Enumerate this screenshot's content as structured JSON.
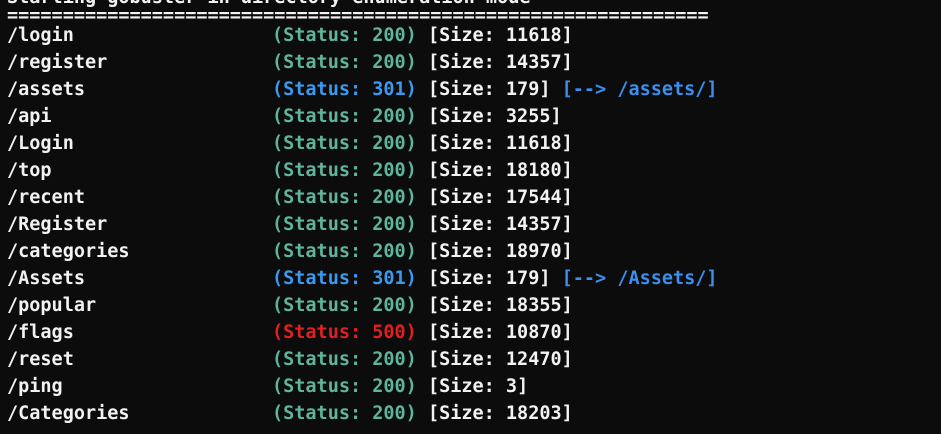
{
  "terminal": {
    "banner": "Starting gobuster in directory enumeration mode",
    "divider": "===============================================================",
    "entries": [
      {
        "path": "/login",
        "status": "200",
        "size": "11618",
        "redirect": ""
      },
      {
        "path": "/register",
        "status": "200",
        "size": "14357",
        "redirect": ""
      },
      {
        "path": "/assets",
        "status": "301",
        "size": "179",
        "redirect": "[--> /assets/]"
      },
      {
        "path": "/api",
        "status": "200",
        "size": "3255",
        "redirect": ""
      },
      {
        "path": "/Login",
        "status": "200",
        "size": "11618",
        "redirect": ""
      },
      {
        "path": "/top",
        "status": "200",
        "size": "18180",
        "redirect": ""
      },
      {
        "path": "/recent",
        "status": "200",
        "size": "17544",
        "redirect": ""
      },
      {
        "path": "/Register",
        "status": "200",
        "size": "14357",
        "redirect": ""
      },
      {
        "path": "/categories",
        "status": "200",
        "size": "18970",
        "redirect": ""
      },
      {
        "path": "/Assets",
        "status": "301",
        "size": "179",
        "redirect": "[--> /Assets/]"
      },
      {
        "path": "/popular",
        "status": "200",
        "size": "18355",
        "redirect": ""
      },
      {
        "path": "/flags",
        "status": "500",
        "size": "10870",
        "redirect": ""
      },
      {
        "path": "/reset",
        "status": "200",
        "size": "12470",
        "redirect": ""
      },
      {
        "path": "/ping",
        "status": "200",
        "size": "3",
        "redirect": ""
      },
      {
        "path": "/Categories",
        "status": "200",
        "size": "18203",
        "redirect": ""
      }
    ]
  },
  "labels": {
    "status_prefix": "(Status: ",
    "status_suffix": ")",
    "size_prefix": " [Size: ",
    "size_suffix": "]"
  },
  "colors": {
    "background": "#0c0c0c",
    "text": "#f2f2f2",
    "status_200": "#5fb59c",
    "status_301": "#3a9af0",
    "status_500": "#e02020",
    "redirect": "#3a8ff0"
  }
}
